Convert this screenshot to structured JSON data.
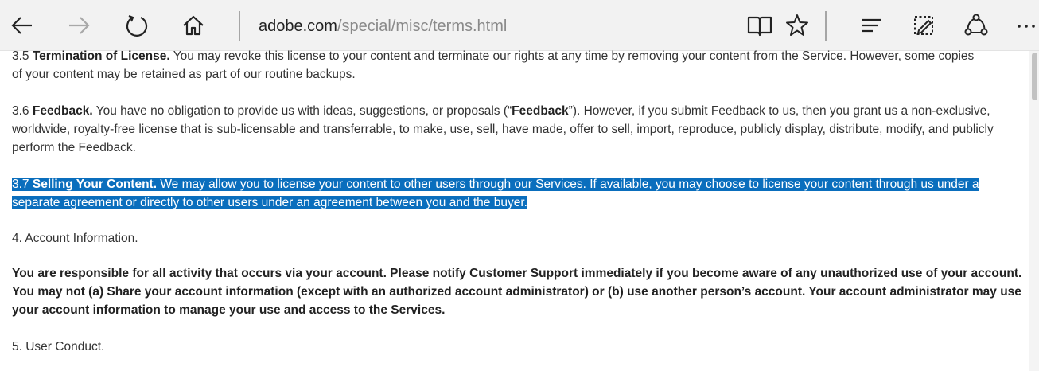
{
  "browser": {
    "url_domain": "adobe.com",
    "url_path": "/special/misc/terms.html",
    "icons": [
      "back-icon",
      "forward-icon",
      "refresh-icon",
      "home-icon",
      "reading-view-icon",
      "favorite-star-icon",
      "hub-icon",
      "web-note-icon",
      "share-icon",
      "more-icon"
    ]
  },
  "terms": {
    "s35": {
      "number": "3.5 ",
      "heading": "Termination of License.",
      "body_line1": " You may revoke this license to your content and terminate our rights at any time by removing your content from the Service. However, some copies",
      "body_line2": "of your content may be retained as part of our routine backups."
    },
    "s36": {
      "number": "3.6 ",
      "heading": "Feedback.",
      "body_pre": " You have no obligation to provide us with ideas, suggestions, or proposals (“",
      "term": "Feedback",
      "body_post": "”). However, if you submit Feedback to us, then you grant us a non-exclusive, worldwide, royalty-free license that is sub-licensable and transferrable, to make, use, sell, have made, offer to sell, import, reproduce, publicly display, distribute, modify, and publicly perform the Feedback."
    },
    "s37": {
      "number": "3.7 ",
      "heading": "Selling Your Content.",
      "body_line1": " We may allow you to license your content to other users through our Services. If available, you may choose to license your content through us under a",
      "body_line2": "separate agreement or directly to other users under an agreement between you and the buyer."
    },
    "s4": {
      "title": "4. Account Information.",
      "body": "You are responsible for all activity that occurs via your account. Please notify Customer Support immediately if you become aware of any unauthorized use of your account. You may not (a) Share your account information (except with an authorized account administrator) or (b) use another person’s account. Your account administrator may use your account information to manage your use and access to the Services."
    },
    "s5": {
      "title": "5. User Conduct."
    }
  },
  "colors": {
    "selection": "#0a6ebd",
    "toolbar": "#f2f2f2"
  }
}
